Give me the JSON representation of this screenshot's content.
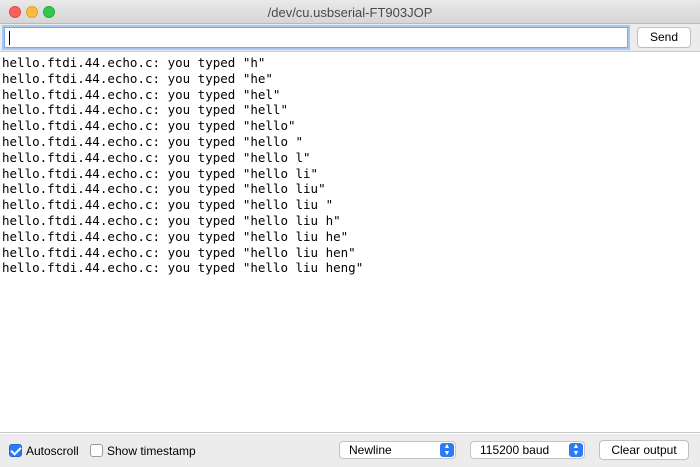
{
  "window": {
    "title": "/dev/cu.usbserial-FT903JOP"
  },
  "input": {
    "value": "",
    "send_label": "Send"
  },
  "output": {
    "lines": [
      "hello.ftdi.44.echo.c: you typed \"h\"",
      "hello.ftdi.44.echo.c: you typed \"he\"",
      "hello.ftdi.44.echo.c: you typed \"hel\"",
      "hello.ftdi.44.echo.c: you typed \"hell\"",
      "hello.ftdi.44.echo.c: you typed \"hello\"",
      "hello.ftdi.44.echo.c: you typed \"hello \"",
      "hello.ftdi.44.echo.c: you typed \"hello l\"",
      "hello.ftdi.44.echo.c: you typed \"hello li\"",
      "hello.ftdi.44.echo.c: you typed \"hello liu\"",
      "hello.ftdi.44.echo.c: you typed \"hello liu \"",
      "hello.ftdi.44.echo.c: you typed \"hello liu h\"",
      "hello.ftdi.44.echo.c: you typed \"hello liu he\"",
      "hello.ftdi.44.echo.c: you typed \"hello liu hen\"",
      "hello.ftdi.44.echo.c: you typed \"hello liu heng\""
    ]
  },
  "bottom": {
    "autoscroll_label": "Autoscroll",
    "autoscroll_checked": true,
    "timestamp_label": "Show timestamp",
    "timestamp_checked": false,
    "line_ending": "Newline",
    "baud_rate": "115200 baud",
    "clear_label": "Clear output"
  },
  "colors": {
    "accent": "#2d7bf4",
    "close": "#fc605c",
    "minimize": "#fdbc40",
    "maximize": "#34c84a"
  }
}
